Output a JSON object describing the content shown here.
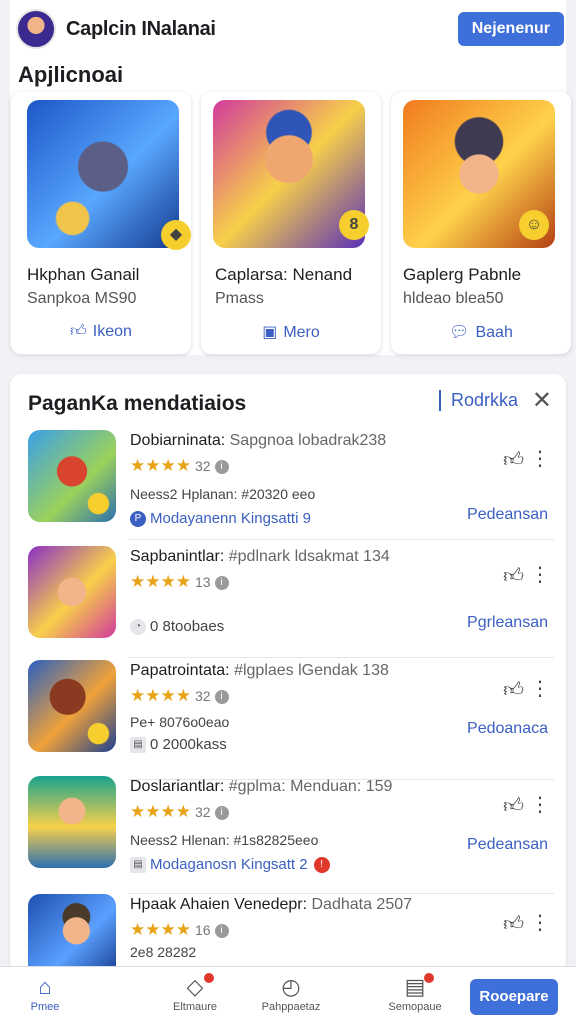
{
  "header": {
    "title": "Caplcin INalanai",
    "button_label": "Nejenenur"
  },
  "featured": {
    "title": "Apjlicnoai",
    "cards": [
      {
        "name": "Hkphan Ganail",
        "sub": "Sanpkoa MS90",
        "action": "Ikeon",
        "action_icon": "thumbs-up-icon",
        "badge": "◆"
      },
      {
        "name": "Caplarsa: Nenand",
        "sub": "Pmass",
        "action": "Mero",
        "action_icon": "square-icon",
        "badge": "8"
      },
      {
        "name": "Gaplerg Pabnle",
        "sub": "hldeao blea50",
        "action": "Baah",
        "action_icon": "chat-icon",
        "badge": "☺"
      }
    ]
  },
  "list": {
    "title": "PaganKa mendatiaios",
    "link_label": "Rodrkka",
    "items": [
      {
        "title": "Dobiarninata:",
        "subtitle": "Sapgnoa lobadrak238",
        "rating_count": "32",
        "meta": "Neess2 Hplanan: #20320 eeo",
        "foot": "Modayanenn Kingsatti 9",
        "foot_style": "link",
        "button": "Pedeansan"
      },
      {
        "title": "Sapbanintlar:",
        "subtitle": "#pdlnark ldsakmat 134",
        "rating_count": "13",
        "meta": "",
        "foot": "0 8toobaes",
        "foot_style": "plain",
        "button": "Pgrleansan"
      },
      {
        "title": "Papatrointata:",
        "subtitle": "#lgplaes lGendak 138",
        "rating_count": "32",
        "meta": "Pe+ 8076o0eao",
        "foot": "0 2000kass",
        "foot_style": "plain",
        "button": "Pedoanaca"
      },
      {
        "title": "Doslariantlar:",
        "subtitle": "#gplma: Menduan: 159",
        "rating_count": "32",
        "meta": "Neess2 Hlenan: #1s82825eeo",
        "foot": "Modaganosn Kingsatt 2",
        "foot_style": "link",
        "button": "Pedeansan"
      },
      {
        "title": "Hpaak Ahaien Venedepr:",
        "subtitle": "Dadhata 2507",
        "rating_count": "16",
        "meta": "2e8 28282",
        "foot": "",
        "foot_style": "plain",
        "button": ""
      }
    ]
  },
  "bottom_nav": {
    "items": [
      {
        "label": "Pmee",
        "icon": "home-icon",
        "active": true,
        "dot": false
      },
      {
        "label": "Eltmaure",
        "icon": "tag-icon",
        "active": false,
        "dot": true
      },
      {
        "label": "Pahppaetaz",
        "icon": "clock-icon",
        "active": false,
        "dot": false
      },
      {
        "label": "Semopaue",
        "icon": "calendar-icon",
        "active": false,
        "dot": true
      }
    ],
    "cta": "Rooepare"
  },
  "colors": {
    "accent": "#3f6fd8",
    "star": "#e8a317",
    "badge_yellow": "#f6cf2e"
  }
}
